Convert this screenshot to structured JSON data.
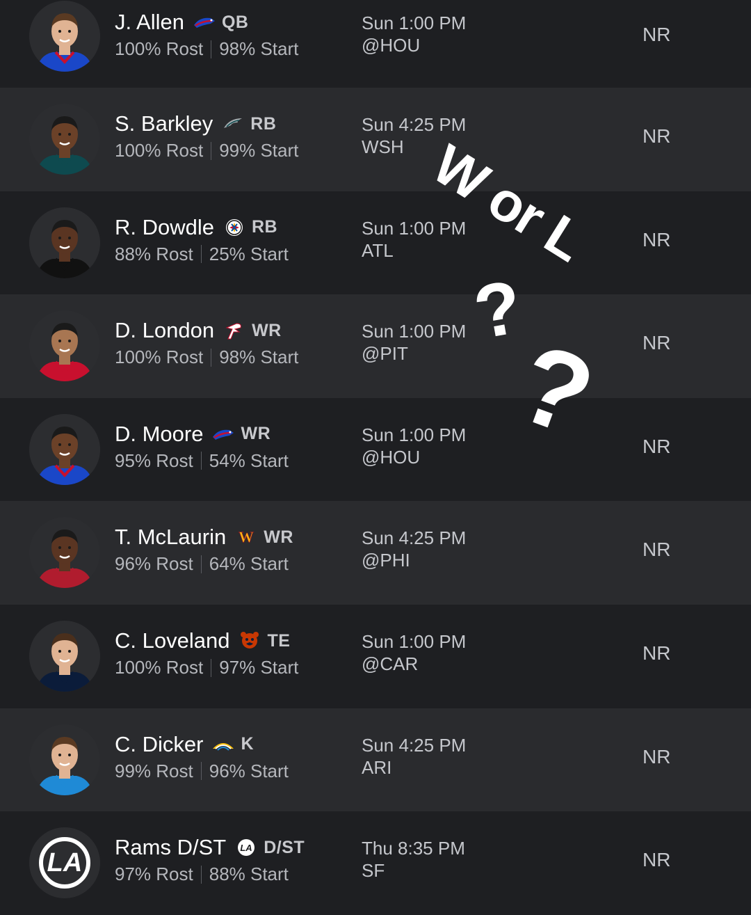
{
  "players": [
    {
      "name": "J. Allen",
      "team_icon": "bills-logo-icon",
      "position": "QB",
      "rostered": "100% Rost",
      "started": "98% Start",
      "game_time": "Sun 1:00 PM",
      "opponent": "@HOU",
      "rank": "NR",
      "jersey": "#1a47c8",
      "jersey_trim": "#c8102e",
      "skin": "#e0b393",
      "hair": "#5a3a22"
    },
    {
      "name": "S. Barkley",
      "team_icon": "eagles-logo-icon",
      "position": "RB",
      "rostered": "100% Rost",
      "started": "99% Start",
      "game_time": "Sun 4:25 PM",
      "opponent": "WSH",
      "rank": "NR",
      "jersey": "#0e4a4f",
      "jersey_trim": "#0e4a4f",
      "skin": "#6b4128",
      "hair": "#1a1a1a"
    },
    {
      "name": "R. Dowdle",
      "team_icon": "steelers-logo-icon",
      "position": "RB",
      "rostered": "88% Rost",
      "started": "25% Start",
      "game_time": "Sun 1:00 PM",
      "opponent": "ATL",
      "rank": "NR",
      "jersey": "#111111",
      "jersey_trim": "#111111",
      "skin": "#5a3522",
      "hair": "#1a1a1a"
    },
    {
      "name": "D. London",
      "team_icon": "falcons-logo-icon",
      "position": "WR",
      "rostered": "100% Rost",
      "started": "98% Start",
      "game_time": "Sun 1:00 PM",
      "opponent": "@PIT",
      "rank": "NR",
      "jersey": "#c8102e",
      "jersey_trim": "#c8102e",
      "skin": "#a87652",
      "hair": "#1a1a1a"
    },
    {
      "name": "D. Moore",
      "team_icon": "bills-logo-icon",
      "position": "WR",
      "rostered": "95% Rost",
      "started": "54% Start",
      "game_time": "Sun 1:00 PM",
      "opponent": "@HOU",
      "rank": "NR",
      "jersey": "#1a47c8",
      "jersey_trim": "#c8102e",
      "skin": "#6b4128",
      "hair": "#1a1a1a"
    },
    {
      "name": "T. McLaurin",
      "team_icon": "commanders-logo-icon",
      "position": "WR",
      "rostered": "96% Rost",
      "started": "64% Start",
      "game_time": "Sun 4:25 PM",
      "opponent": "@PHI",
      "rank": "NR",
      "jersey": "#b01c2e",
      "jersey_trim": "#b01c2e",
      "skin": "#5a3522",
      "hair": "#1a1a1a"
    },
    {
      "name": "C. Loveland",
      "team_icon": "bears-logo-icon",
      "position": "TE",
      "rostered": "100% Rost",
      "started": "97% Start",
      "game_time": "Sun 1:00 PM",
      "opponent": "@CAR",
      "rank": "NR",
      "jersey": "#0b1c3a",
      "jersey_trim": "#0b1c3a",
      "skin": "#e0b393",
      "hair": "#4a2f1c"
    },
    {
      "name": "C. Dicker",
      "team_icon": "chargers-logo-icon",
      "position": "K",
      "rostered": "99% Rost",
      "started": "96% Start",
      "game_time": "Sun 4:25 PM",
      "opponent": "ARI",
      "rank": "NR",
      "jersey": "#1f8ad6",
      "jersey_trim": "#1f8ad6",
      "skin": "#e0b393",
      "hair": "#5a3a22"
    },
    {
      "name": "Rams D/ST",
      "team_icon": "rams-logo-icon",
      "position": "D/ST",
      "rostered": "97% Rost",
      "started": "88% Start",
      "game_time": "Thu 8:35 PM",
      "opponent": "SF",
      "rank": "NR",
      "avatar_type": "rams-logo"
    }
  ],
  "overlay": {
    "text": "W or L",
    "question_marks": [
      "?",
      "?"
    ]
  },
  "colors": {
    "row_dark": "#1e1f22",
    "row_light": "#2a2b2e",
    "text_primary": "#ffffff",
    "text_secondary": "#b5b7bc"
  }
}
